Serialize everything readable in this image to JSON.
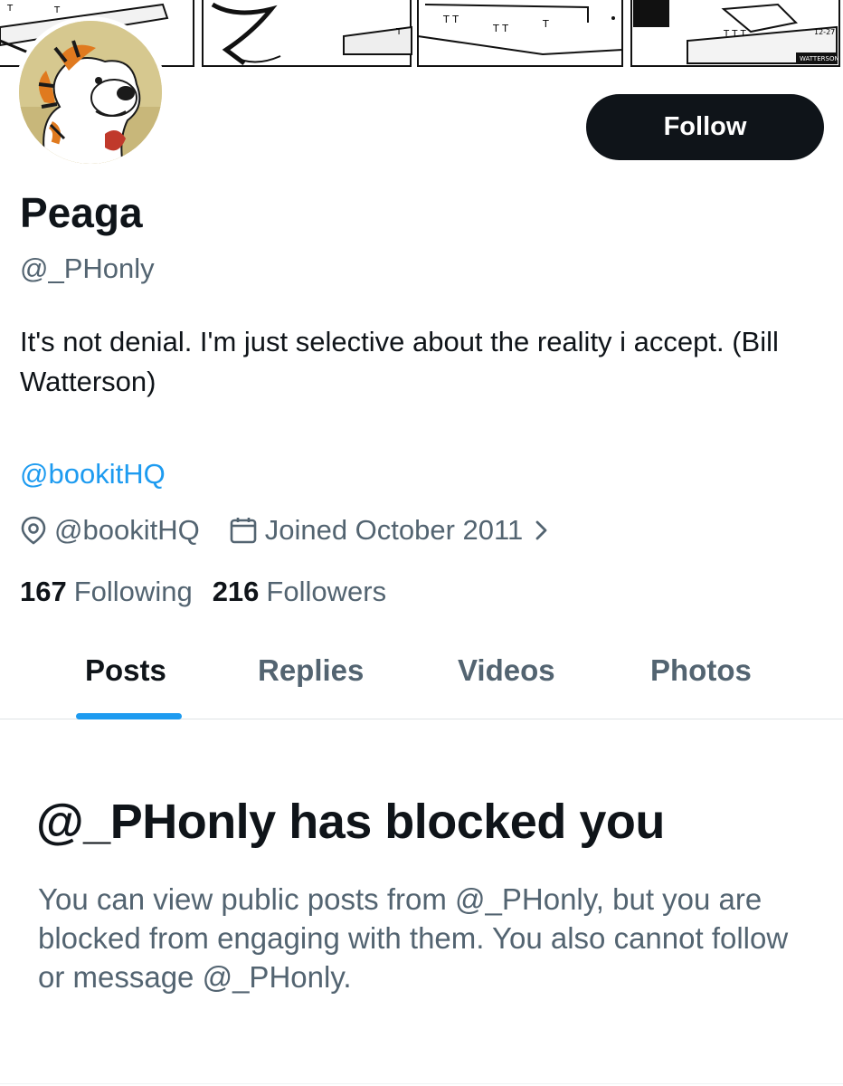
{
  "profile": {
    "display_name": "Peaga",
    "handle": "@_PHonly",
    "bio": "It's not denial. I'm just selective about the reality i accept. (Bill Watterson)",
    "bio_link": "@bookitHQ",
    "location": "@bookitHQ",
    "joined": "Joined October 2011",
    "following_count": "167",
    "following_label": "Following",
    "followers_count": "216",
    "followers_label": "Followers"
  },
  "actions": {
    "follow_label": "Follow"
  },
  "tabs": [
    {
      "label": "Posts",
      "active": true
    },
    {
      "label": "Replies",
      "active": false
    },
    {
      "label": "Videos",
      "active": false
    },
    {
      "label": "Photos",
      "active": false
    }
  ],
  "blocked": {
    "title": "@_PHonly has blocked you",
    "description": "You can view public posts from @_PHonly, but you are blocked from engaging with them. You also cannot follow or message @_PHonly."
  },
  "banner": {
    "date_stamp": "12-27",
    "signature": "WATTERSON"
  },
  "icons": {
    "location": "location-pin-icon",
    "calendar": "calendar-icon",
    "chevron": "chevron-right-icon"
  },
  "colors": {
    "accent": "#1d9bf0",
    "text_primary": "#0f1419",
    "text_secondary": "#536471",
    "button_bg": "#0f1419"
  }
}
